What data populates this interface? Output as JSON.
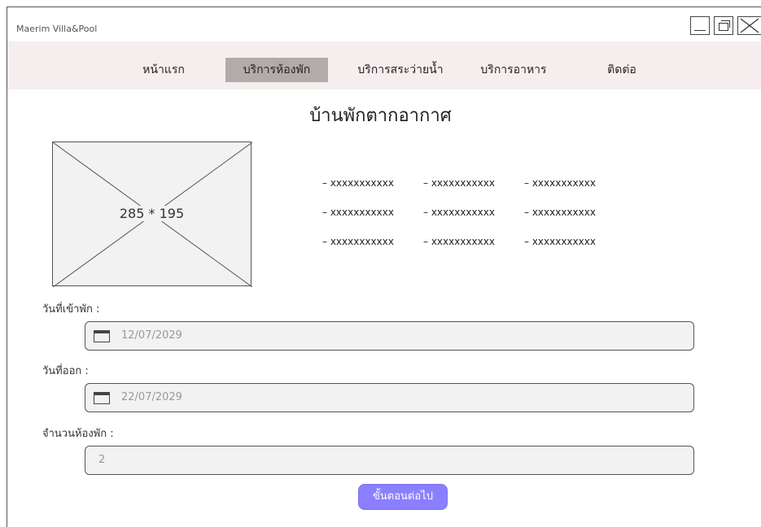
{
  "window": {
    "title": "Maerim Villa&Pool",
    "controls": [
      "minimize-icon",
      "maximize-icon",
      "close-icon"
    ]
  },
  "nav": {
    "items": [
      {
        "label": "หน้าแรก",
        "active": false
      },
      {
        "label": "บริการห้องพัก",
        "active": true
      },
      {
        "label": "บริการสระว่ายน้ำ",
        "active": false
      },
      {
        "label": "บริการอาหาร",
        "active": false
      },
      {
        "label": "ติดต่อ",
        "active": false
      }
    ]
  },
  "page": {
    "title": "บ้านพักตากอากาศ"
  },
  "image_placeholder": {
    "label": "285 * 195"
  },
  "amenities": [
    [
      "– xxxxxxxxxxx",
      "– xxxxxxxxxxx",
      "– xxxxxxxxxxx"
    ],
    [
      "– xxxxxxxxxxx",
      "– xxxxxxxxxxx",
      "– xxxxxxxxxxx"
    ],
    [
      "– xxxxxxxxxxx",
      "– xxxxxxxxxxx",
      "– xxxxxxxxxxx"
    ]
  ],
  "form": {
    "checkin": {
      "label": "วันที่เข้าพัก :",
      "value": "12/07/2029",
      "icon": "calendar-icon"
    },
    "checkout": {
      "label": "วันที่ออก :",
      "value": "22/07/2029",
      "icon": "calendar-icon"
    },
    "rooms": {
      "label": "จำนวนห้องพัก :",
      "value": "2"
    }
  },
  "next_button": {
    "label": "ขั้นตอนต่อไป",
    "color": "#8a80ff"
  },
  "colors": {
    "navbar_bg": "#f6eeee",
    "active_tab_bg": "#b3aba9",
    "field_bg": "#f2f2f2"
  }
}
